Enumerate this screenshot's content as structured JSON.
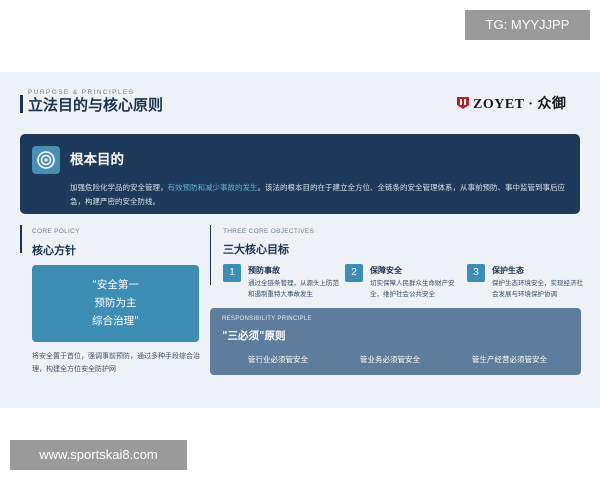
{
  "overlay_tag": "TG: MYYJJPP",
  "footer_url": "www.sportskai8.com",
  "header": {
    "eyebrow": "PURPOSE & PRINCIPLES",
    "title": "立法目的与核心原则",
    "logo_text": "ZOYET · 众御"
  },
  "purpose": {
    "icon": "target-icon",
    "title": "根本目的",
    "body_pre": "加强危险化学品的安全管理，",
    "body_highlight": "有效预防和减少事故的发生",
    "body_post": "。该法的根本目的在于建立全方位、全链条的安全管理体系，从事前预防、事中监管到事后应急，构建严密的安全防线。"
  },
  "policy": {
    "cap": "CORE POLICY",
    "title": "核心方针",
    "quote_line1": "\"安全第一",
    "quote_line2": "预防为主",
    "quote_line3": "综合治理\"",
    "desc": "将安全置于首位，强调事前预防，通过多种手段综合治理，构建全方位安全防护网"
  },
  "objectives": {
    "cap": "THREE CORE OBJECTIVES",
    "title": "三大核心目标",
    "items": [
      {
        "num": "1",
        "title": "预防事故",
        "body": "通过全链条管理，从源头上防范和遏制重特大事故发生"
      },
      {
        "num": "2",
        "title": "保障安全",
        "body": "切实保障人民群众生命财产安全，维护社会公共安全"
      },
      {
        "num": "3",
        "title": "保护生态",
        "body": "保护生态环境安全，实现经济社会发展与环境保护协调"
      }
    ]
  },
  "responsibility": {
    "cap": "RESPONSIBILITY PRINCIPLE",
    "title": "\"三必须\"原则",
    "items": [
      "管行业必须管安全",
      "管业务必须管安全",
      "管生产经营必须管安全"
    ]
  },
  "colors": {
    "navy": "#1e3a5a",
    "accent_blue": "#3e8db5",
    "highlight": "#5fb0d9",
    "slate": "#5e7c9b",
    "logo_red": "#b3202a"
  }
}
